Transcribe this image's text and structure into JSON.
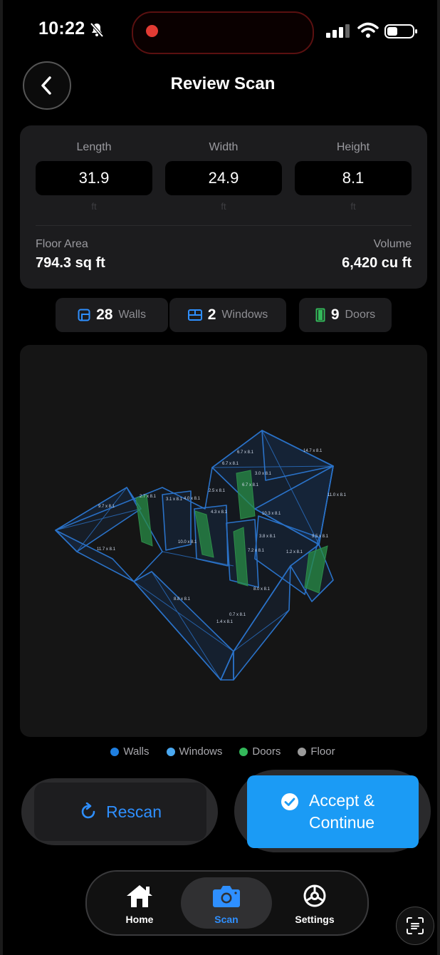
{
  "status_bar": {
    "time": "10:22"
  },
  "header": {
    "title": "Review Scan"
  },
  "dimensions": [
    {
      "label": "Length",
      "value": "31.9",
      "unit": "ft"
    },
    {
      "label": "Width",
      "value": "24.9",
      "unit": "ft"
    },
    {
      "label": "Height",
      "value": "8.1",
      "unit": "ft"
    }
  ],
  "summary": {
    "floor_area_label": "Floor Area",
    "floor_area_value": "794.3 sq ft",
    "volume_label": "Volume",
    "volume_value": "6,420 cu ft"
  },
  "counts": [
    {
      "count": "28",
      "label": "Walls",
      "icon": "wall-icon"
    },
    {
      "count": "2",
      "label": "Windows",
      "icon": "window-icon"
    },
    {
      "count": "9",
      "label": "Doors",
      "icon": "door-icon"
    }
  ],
  "legend": [
    {
      "label": "Walls",
      "color": "#1f7fe0"
    },
    {
      "label": "Windows",
      "color": "#4aa8f0"
    },
    {
      "label": "Doors",
      "color": "#33b85a"
    },
    {
      "label": "Floor",
      "color": "#9a9a9a"
    }
  ],
  "actions": {
    "rescan": "Rescan",
    "accept_line1": "Accept &",
    "accept_line2": "Continue"
  },
  "tabs": [
    {
      "label": "Home",
      "icon": "home-icon"
    },
    {
      "label": "Scan",
      "icon": "camera-icon",
      "active": true
    },
    {
      "label": "Settings",
      "icon": "gear-icon"
    }
  ],
  "colors": {
    "accent": "#1b9bf5",
    "wall": "#2a7fd4",
    "door": "#2e8b4a"
  }
}
